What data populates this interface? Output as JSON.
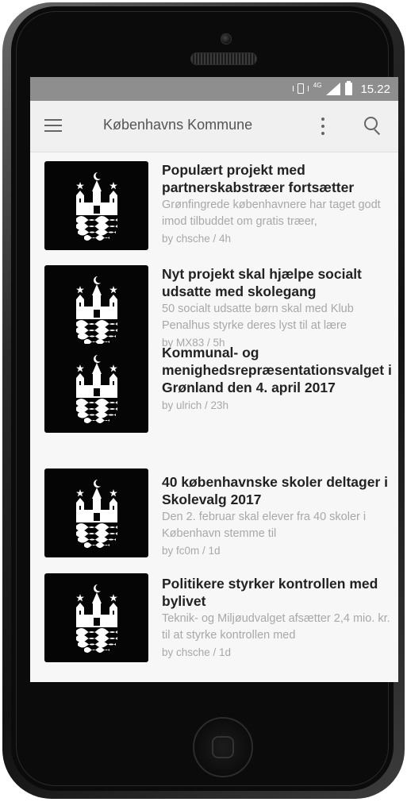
{
  "status_bar": {
    "network": "4G",
    "time": "15.22"
  },
  "app_bar": {
    "title": "Københavns Kommune"
  },
  "articles": [
    {
      "title": "Populært projekt med partnerskabstræer fortsætter",
      "summary": "Grønfingrede københavnere har taget godt imod tilbuddet om gratis træer,",
      "meta": "by chsche / 4h"
    },
    {
      "title": "Nyt projekt skal hjælpe socialt udsatte med skolegang",
      "summary": "50 socialt udsatte børn skal med Klub Penalhus styrke deres lyst til at lære",
      "meta": "by MX83 / 5h"
    },
    {
      "title": "Kommunal- og menighedsrepræsentationsvalget i Grønland den 4. april 2017",
      "summary": "",
      "meta": "by ulrich / 23h"
    },
    {
      "title": "40 københavnske skoler deltager i Skolevalg 2017",
      "summary": "Den 2. februar skal elever fra 40 skoler i København stemme til",
      "meta": "by fc0m / 1d"
    },
    {
      "title": "Politikere styrker kontrollen med bylivet",
      "summary": "Teknik- og Miljøudvalget afsætter 2,4 mio. kr. til at styrke kontrollen med",
      "meta": "by chsche / 1d"
    }
  ],
  "icons": {
    "menu": "menu-icon",
    "more": "more-vert-icon",
    "search": "search-icon",
    "thumbnail": "copenhagen-coat-of-arms-icon"
  },
  "colors": {
    "status_bar": "#8e8e8e",
    "app_bar": "#f0f0f0",
    "title_text": "#222222",
    "secondary_text": "#a8a8a8"
  }
}
